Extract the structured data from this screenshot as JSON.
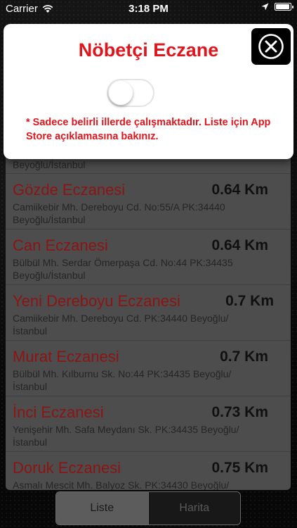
{
  "status_bar": {
    "carrier": "Carrier",
    "time": "3:18 PM"
  },
  "modal": {
    "title": "Nöbetçi Eczane",
    "toggle_on": false,
    "note": "* Sadece belirli illerde çalışmaktadır. Liste için App Store açıklamasına bakınız."
  },
  "pharmacies": [
    {
      "name": "",
      "distance": "",
      "address": "Beyoğlu/İstanbul"
    },
    {
      "name": "Gözde Eczanesi",
      "distance": "0.64 Km",
      "address": "Camiikebir Mh. Dereboyu Cd. No:55/A PK:34440 Beyoğlu/İstanbul"
    },
    {
      "name": "Can Eczanesi",
      "distance": "0.64 Km",
      "address": "Bülbül Mh. Serdar Ömerpaşa Cd. No:44 PK:34435 Beyoğlu/İstanbul"
    },
    {
      "name": "Yeni Dereboyu Eczanesi",
      "distance": "0.7 Km",
      "address": "Camiikebir Mh. Dereboyu Cd. PK:34440 Beyoğlu/ İstanbul"
    },
    {
      "name": "Murat Eczanesi",
      "distance": "0.7 Km",
      "address": "Bülbül Mh. Kılburnu Sk. No:44 PK:34435 Beyoğlu/ İstanbul"
    },
    {
      "name": "İnci Eczanesi",
      "distance": "0.73 Km",
      "address": "Yenişehir Mh. Safa Meydanı Sk. PK:34435 Beyoğlu/İstanbul"
    },
    {
      "name": "Doruk Eczanesi",
      "distance": "0.75 Km",
      "address": "Asmalı Mescit Mh. Balyoz Sk. PK:34430 Beyoğlu/"
    }
  ],
  "segments": {
    "list_label": "Liste",
    "map_label": "Harita",
    "selected": "Liste"
  },
  "colors": {
    "accent_red": "#e0161e",
    "pharmacy_name": "#8c1414"
  }
}
